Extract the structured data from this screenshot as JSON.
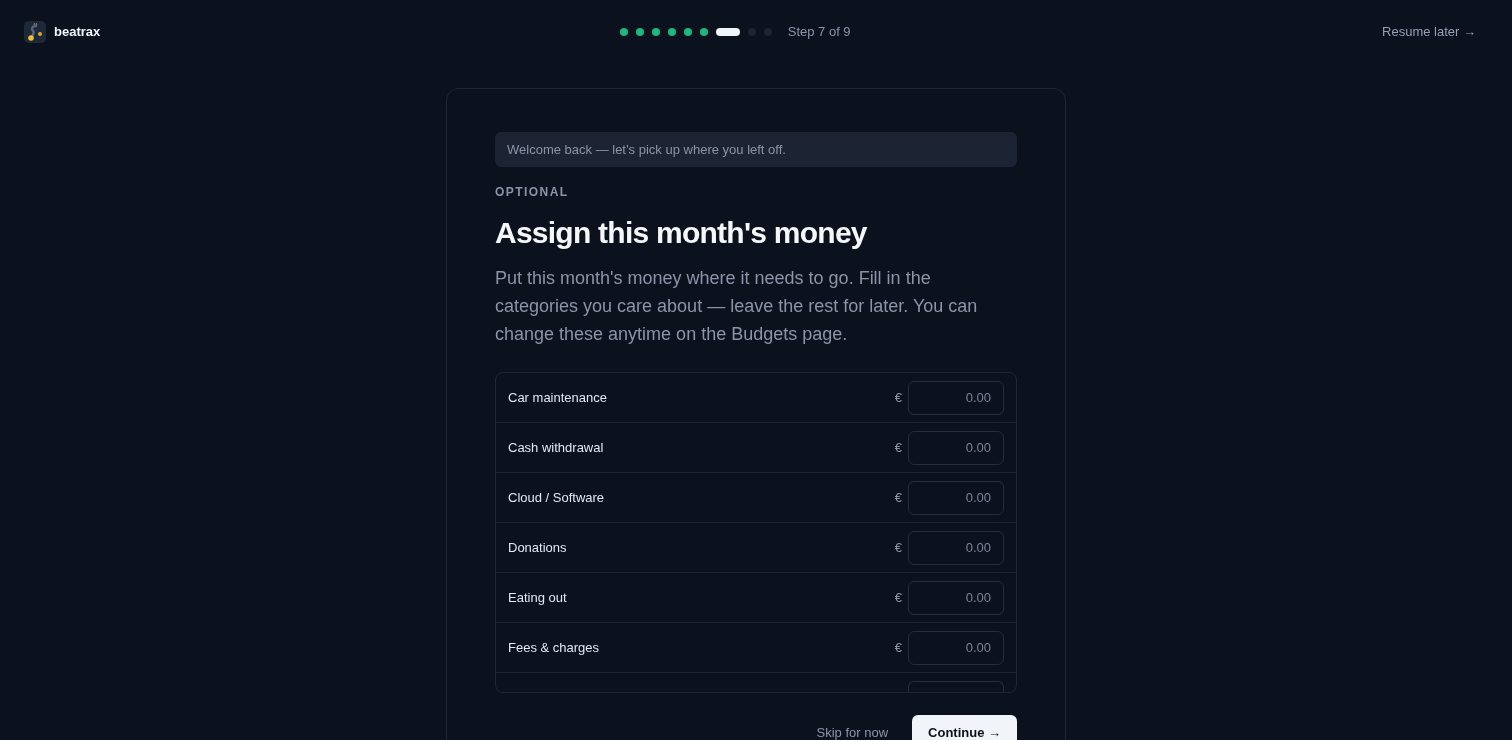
{
  "brand": {
    "name": "beatrax"
  },
  "progress": {
    "steps": [
      {
        "done": true,
        "selected": false
      },
      {
        "done": true,
        "selected": false
      },
      {
        "done": true,
        "selected": false
      },
      {
        "done": true,
        "selected": false
      },
      {
        "done": true,
        "selected": false
      },
      {
        "done": true,
        "selected": false
      },
      {
        "done": false,
        "selected": true
      },
      {
        "done": false,
        "selected": false
      },
      {
        "done": false,
        "selected": false
      }
    ],
    "label": "Step 7 of 9"
  },
  "header_link": "Resume later →",
  "card": {
    "banner": "Welcome back — let’s pick up where you left off.",
    "eyebrow": "OPTIONAL",
    "title": "Assign this month's money",
    "description": "Put this month's money where it needs to go. Fill in the categories you care about — leave the rest for later. You can change these anytime on the Budgets page.",
    "categories": [
      {
        "kind": "row",
        "label": "Car maintenance",
        "currency": "€",
        "placeholder": "0.00"
      },
      {
        "kind": "row",
        "label": "Cash withdrawal",
        "currency": "€",
        "placeholder": "0.00"
      },
      {
        "kind": "row",
        "label": "Cloud / Software",
        "currency": "€",
        "placeholder": "0.00"
      },
      {
        "kind": "row",
        "label": "Donations",
        "currency": "€",
        "placeholder": "0.00"
      },
      {
        "kind": "row",
        "label": "Eating out",
        "currency": "€",
        "placeholder": "0.00"
      },
      {
        "kind": "row",
        "label": "Fees & charges",
        "currency": "€",
        "placeholder": "0.00"
      },
      {
        "kind": "clipped"
      }
    ],
    "actions": {
      "skip": "Skip for now",
      "continue": "Continue →"
    }
  }
}
